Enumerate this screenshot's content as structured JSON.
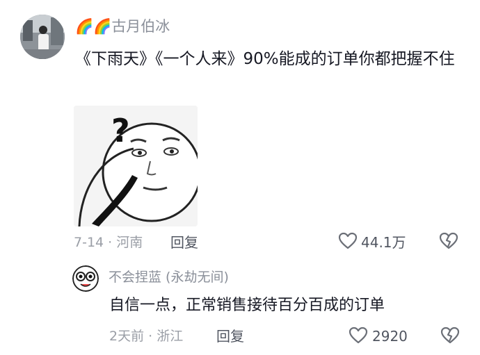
{
  "comment": {
    "badges": [
      "🌈",
      "🌈"
    ],
    "username": "古月伯冰",
    "text": "《下雨天》《一个人来》90%能成的订单你都把握不住",
    "sticker_glyph": "?",
    "date_location": "7-14 · 河南",
    "reply_label": "回复",
    "like_count": "44.1万"
  },
  "reply": {
    "username": "不会捏蓝 (永劫无间)",
    "text": "自信一点，正常销售接待百分百成的订单",
    "date_location": "2天前 · 浙江",
    "reply_label": "回复",
    "like_count": "2920"
  }
}
